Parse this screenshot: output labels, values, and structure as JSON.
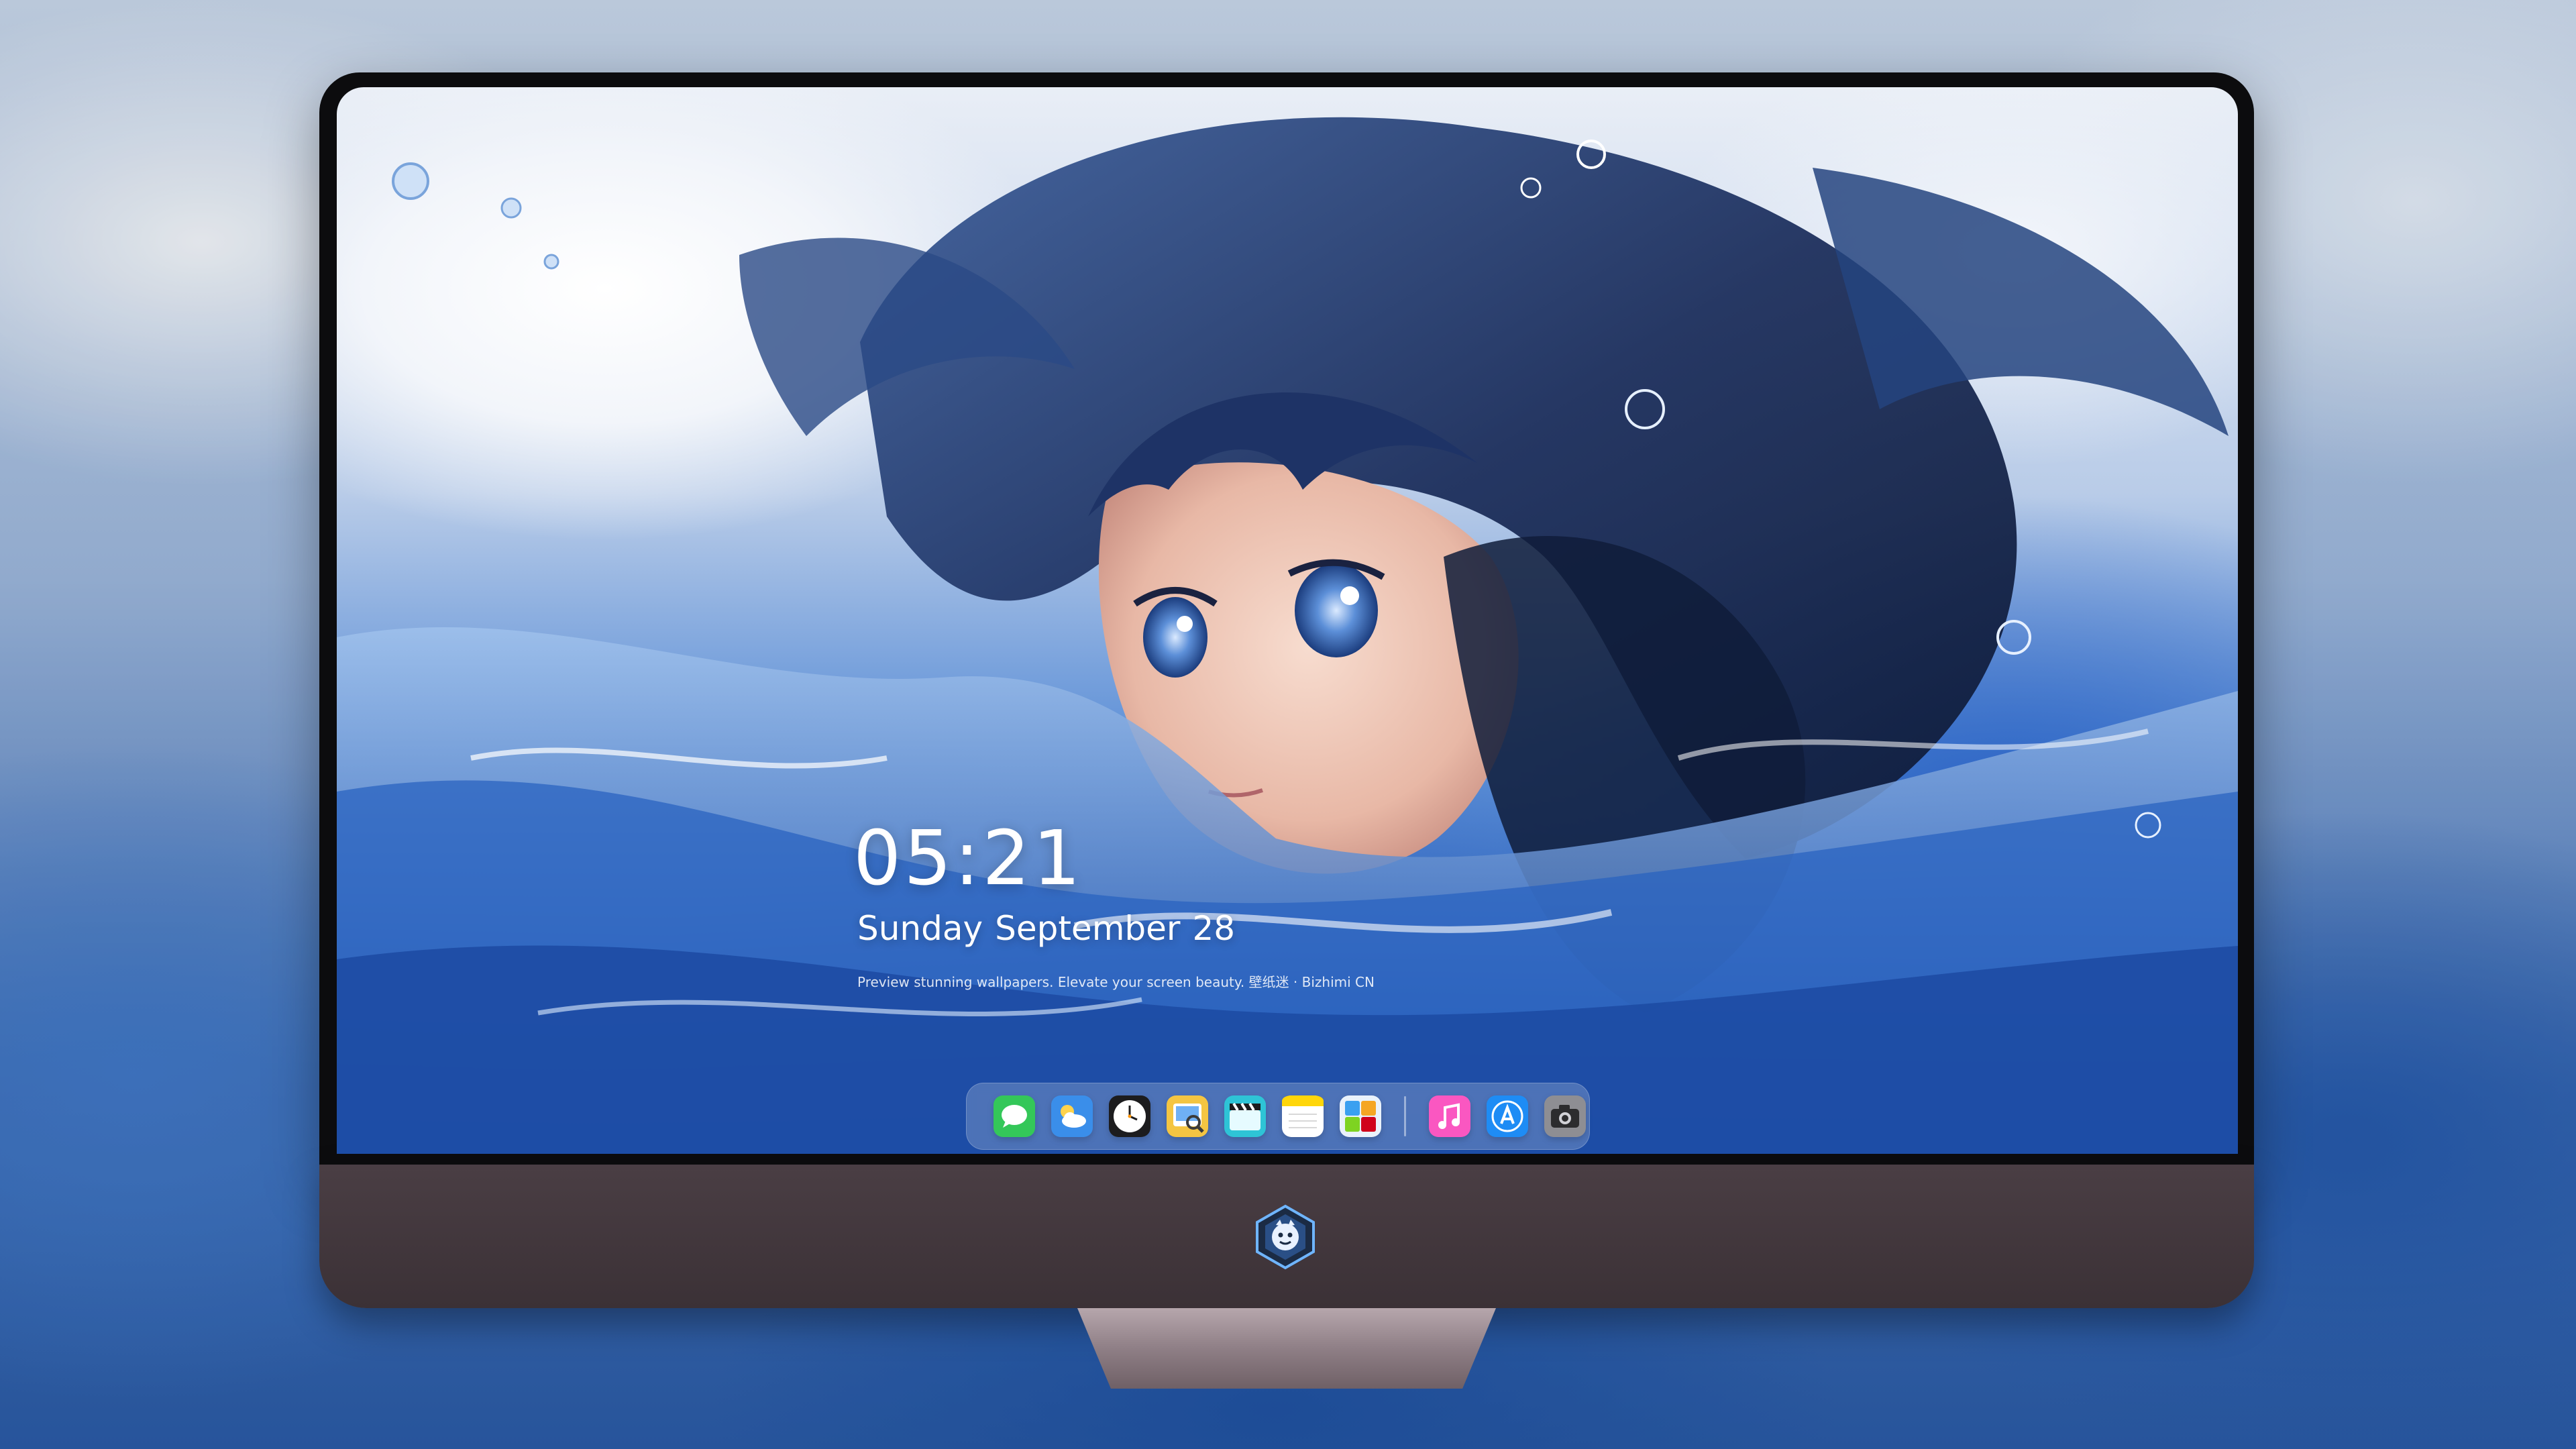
{
  "lockscreen": {
    "time": "05:21",
    "weekday": "Sunday",
    "month": "September",
    "day": "28",
    "caption": "Preview stunning wallpapers. Elevate your screen beauty. 壁纸迷 · Bizhimi CN"
  },
  "dock": {
    "apps": [
      {
        "name": "Messages",
        "icon": "messages-icon",
        "color": "#34c759"
      },
      {
        "name": "Weather",
        "icon": "weather-icon",
        "color": "#3a8eea"
      },
      {
        "name": "Clock",
        "icon": "clock-icon",
        "color": "#ffffff"
      },
      {
        "name": "Preview",
        "icon": "preview-icon",
        "color": "#f4c542"
      },
      {
        "name": "Clips",
        "icon": "clips-icon",
        "color": "#2ec4d6"
      },
      {
        "name": "Notes",
        "icon": "notes-icon",
        "color": "#ffd60a"
      },
      {
        "name": "Photo Booth",
        "icon": "photo-booth-icon",
        "color": "#e9f2fb"
      },
      {
        "name": "Music",
        "icon": "music-icon",
        "color": "#fa57c1"
      },
      {
        "name": "App Store",
        "icon": "app-store-icon",
        "color": "#1e8cf5"
      },
      {
        "name": "Camera",
        "icon": "camera-icon",
        "color": "#8e8e93"
      }
    ]
  },
  "monitor": {
    "logo": "bizhimi-logo-icon"
  }
}
